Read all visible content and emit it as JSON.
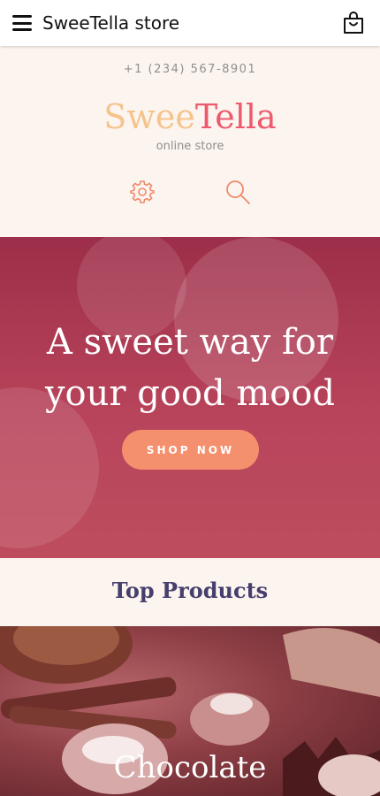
{
  "topbar": {
    "title": "SweeTella store",
    "menu_icon": "hamburger-menu-icon",
    "cart_icon": "shopping-bag-icon"
  },
  "header": {
    "phone": "+1 (234) 567-8901",
    "logo": {
      "part1": "Swee",
      "part2": "Tella"
    },
    "tagline": "online store",
    "icons": [
      "gear-icon",
      "search-icon"
    ]
  },
  "hero": {
    "title_line1": "A sweet way for",
    "title_line2": "your good mood",
    "cta_label": "SHOP NOW"
  },
  "section": {
    "heading": "Top Products"
  },
  "products": [
    {
      "label": "Chocolate"
    }
  ],
  "colors": {
    "accent_orange": "#f5906e",
    "logo_light": "#f5c38c",
    "logo_pink": "#ed5a6e",
    "heading_purple": "#463f6e",
    "hero_bg": "#b8445b",
    "page_bg": "#fcf4ee"
  }
}
